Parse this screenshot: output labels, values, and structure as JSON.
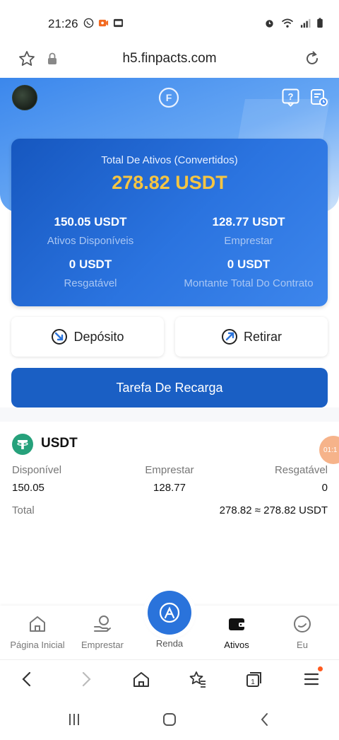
{
  "status_bar": {
    "time": "21:26"
  },
  "browser": {
    "url": "h5.finpacts.com"
  },
  "assets": {
    "total_label": "Total De Ativos (Convertidos)",
    "total_value": "278.82 USDT",
    "available_value": "150.05 USDT",
    "available_label": "Ativos Disponíveis",
    "lend_value": "128.77 USDT",
    "lend_label": "Emprestar",
    "redeemable_value": "0 USDT",
    "redeemable_label": "Resgatável",
    "contract_value": "0 USDT",
    "contract_label": "Montante Total Do Contrato"
  },
  "actions": {
    "deposit_label": "Depósito",
    "withdraw_label": "Retirar",
    "recharge_label": "Tarefa De Recarga"
  },
  "token": {
    "name": "USDT",
    "available_label": "Disponível",
    "available_value": "150.05",
    "lend_label": "Emprestar",
    "lend_value": "128.77",
    "redeemable_label": "Resgatável",
    "redeemable_value": "0",
    "total_label": "Total",
    "total_value": "278.82 ≈ 278.82 USDT"
  },
  "floating_badge": "01:1",
  "nav": {
    "home": "Página Inicial",
    "lend": "Emprestar",
    "income": "Renda",
    "assets": "Ativos",
    "me": "Eu"
  },
  "colors": {
    "accent": "#2a73db",
    "total_value": "#f5c542",
    "card_dark": "#1657bf"
  }
}
